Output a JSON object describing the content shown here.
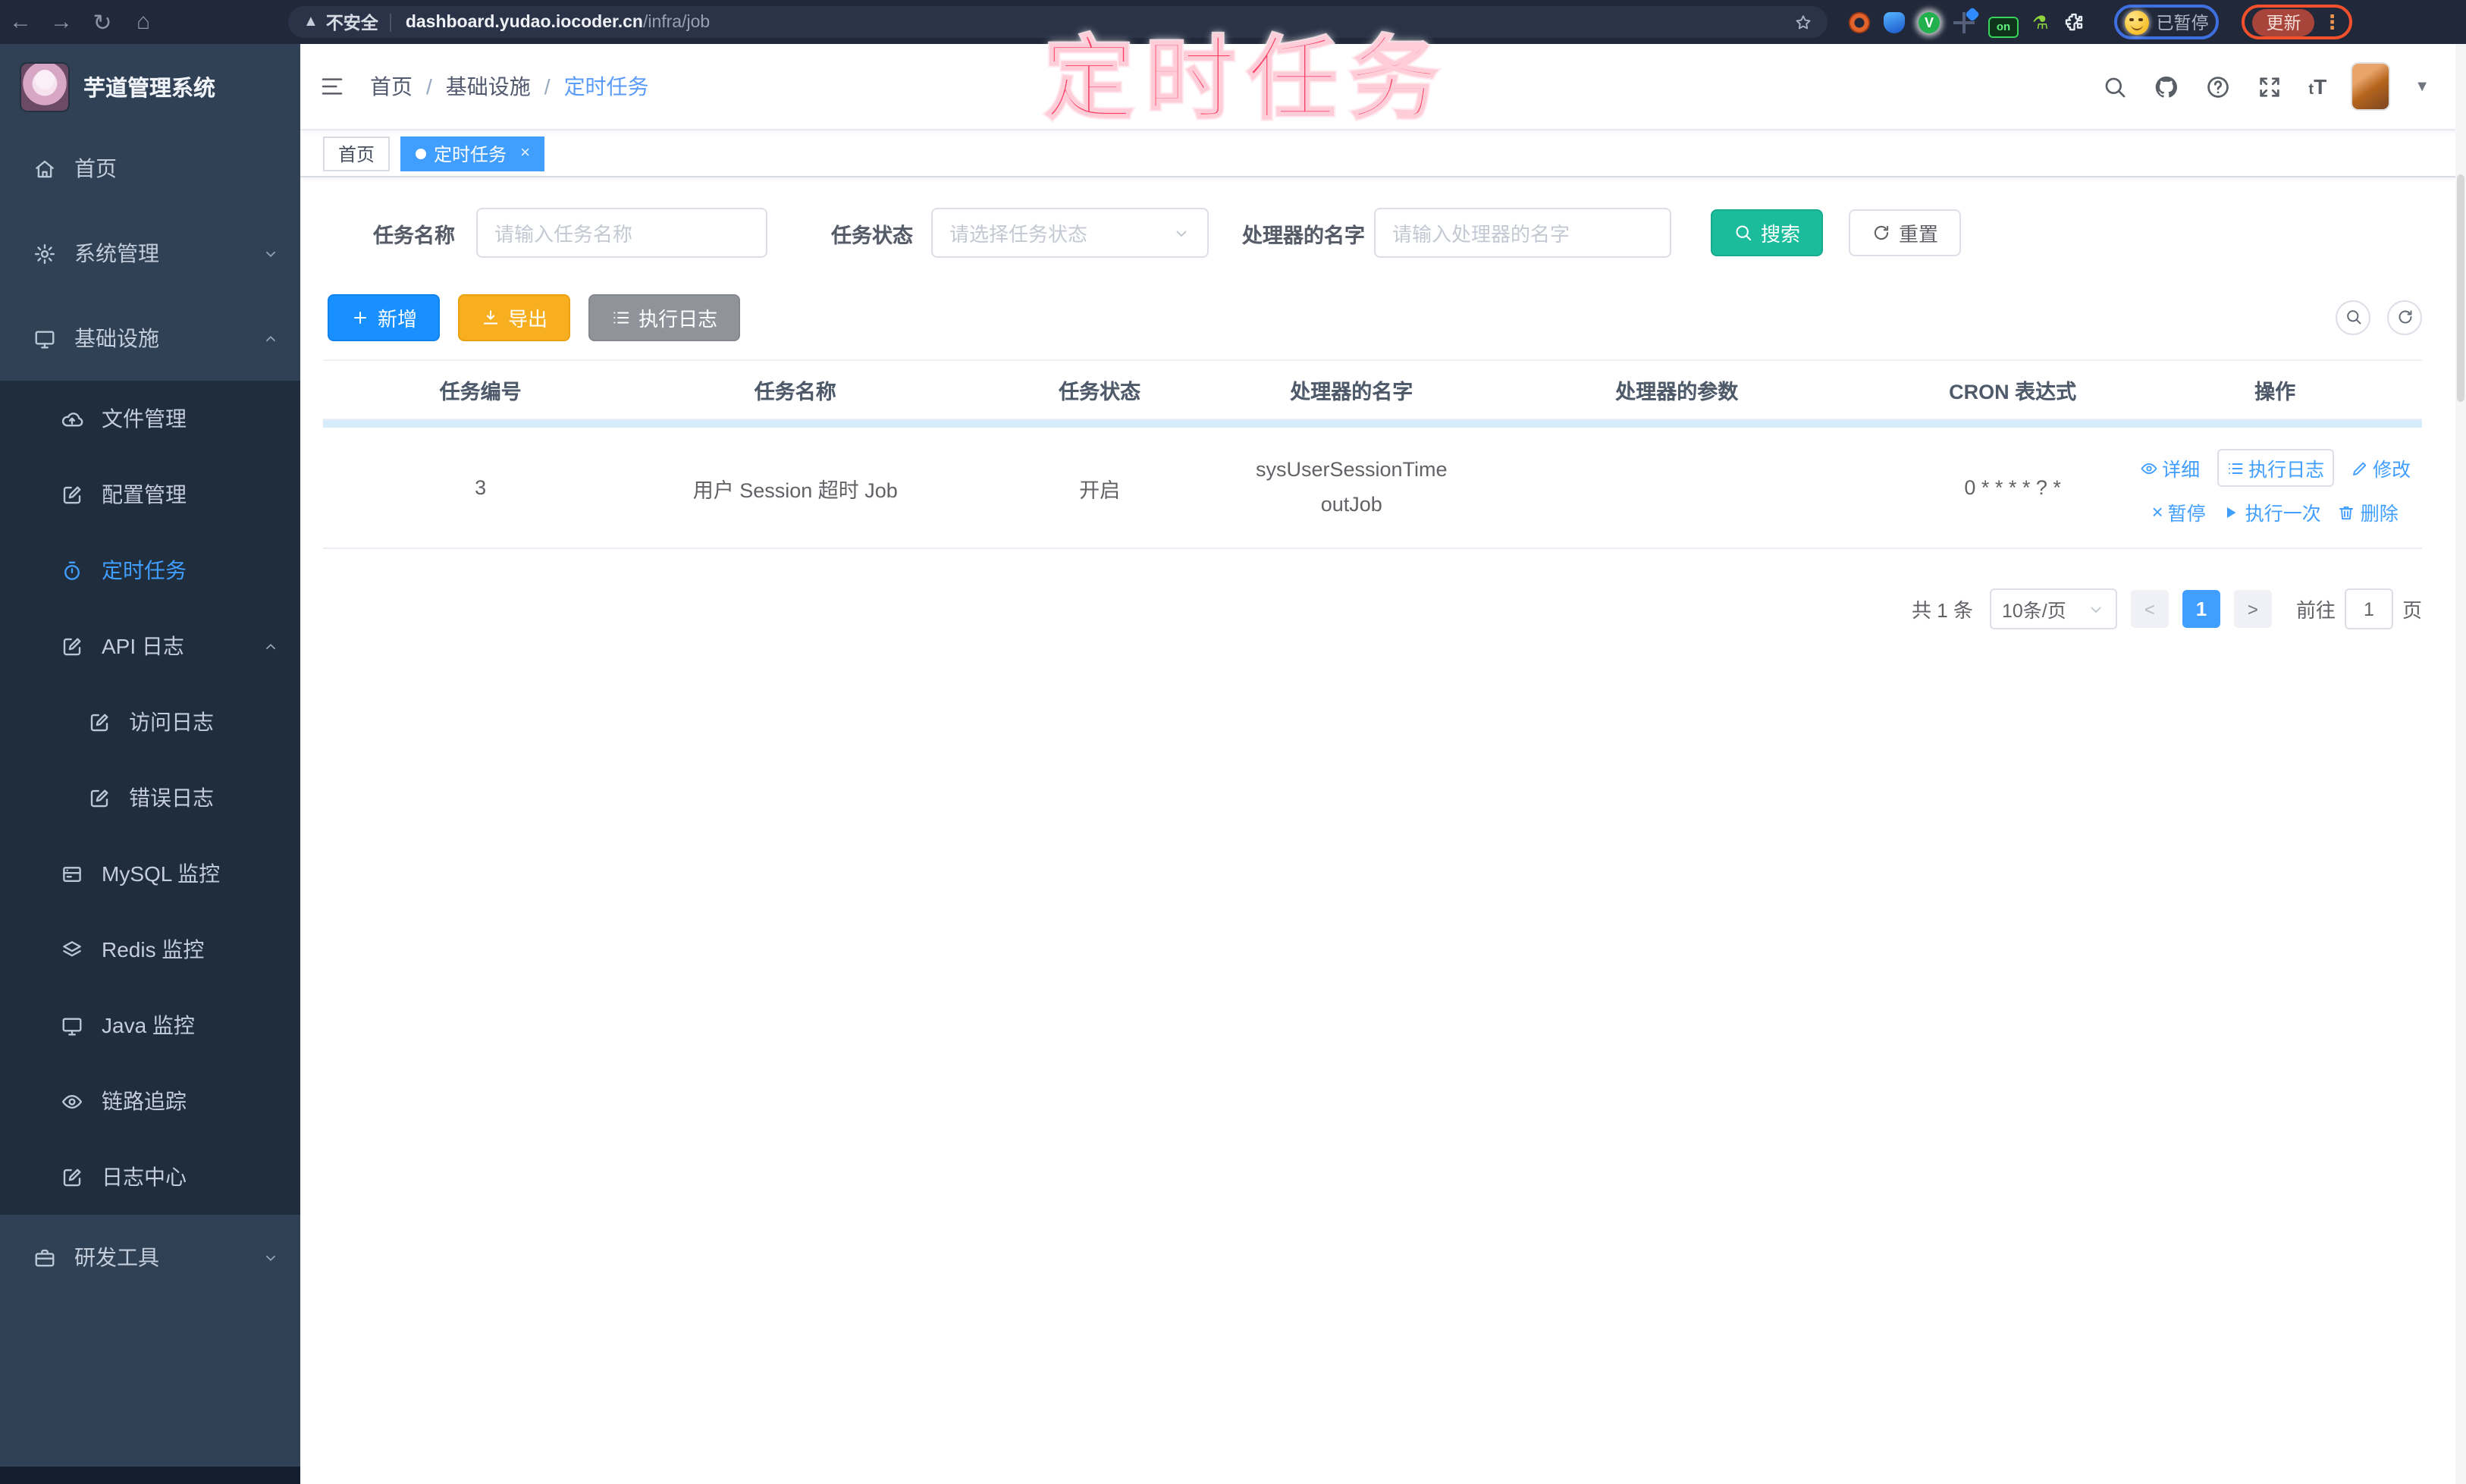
{
  "browser": {
    "security_label": "不安全",
    "url_host": "dashboard.yudao.iocoder.cn",
    "url_path": "/infra/job",
    "ext_on_badge": "on",
    "ext_green_glyph": "V",
    "paused_label": "已暂停",
    "update_label": "更新",
    "kebab_glyph": "⋮",
    "back_glyph": "←",
    "forward_glyph": "→",
    "reload_glyph": "↻",
    "home_glyph": "⌂",
    "warning_glyph": "▲"
  },
  "watermark": "定时任务",
  "sidebar": {
    "logo_title": "芋道管理系统",
    "items": [
      {
        "label": "首页"
      },
      {
        "label": "系统管理"
      },
      {
        "label": "基础设施"
      },
      {
        "label": "文件管理"
      },
      {
        "label": "配置管理"
      },
      {
        "label": "定时任务"
      },
      {
        "label": "API 日志"
      },
      {
        "label": "访问日志"
      },
      {
        "label": "错误日志"
      },
      {
        "label": "MySQL 监控"
      },
      {
        "label": "Redis 监控"
      },
      {
        "label": "Java 监控"
      },
      {
        "label": "链路追踪"
      },
      {
        "label": "日志中心"
      },
      {
        "label": "研发工具"
      }
    ]
  },
  "header": {
    "breadcrumb": [
      "首页",
      "基础设施",
      "定时任务"
    ],
    "breadcrumb_sep": "/",
    "tabs": [
      {
        "label": "首页"
      },
      {
        "label": "定时任务",
        "close_glyph": "×"
      }
    ]
  },
  "filters": {
    "name_label": "任务名称",
    "name_placeholder": "请输入任务名称",
    "status_label": "任务状态",
    "status_placeholder": "请选择任务状态",
    "handler_label": "处理器的名字",
    "handler_placeholder": "请输入处理器的名字",
    "search_label": "搜索",
    "reset_label": "重置"
  },
  "toolbar": {
    "add_label": "新增",
    "export_label": "导出",
    "exec_log_label": "执行日志"
  },
  "table": {
    "columns": [
      "任务编号",
      "任务名称",
      "任务状态",
      "处理器的名字",
      "处理器的参数",
      "CRON 表达式",
      "操作"
    ],
    "rows": [
      {
        "id": "3",
        "name": "用户 Session 超时 Job",
        "status": "开启",
        "handler": "sysUserSessionTimeoutJob",
        "param": "",
        "cron": "0 * * * * ? *"
      }
    ],
    "actions_row1": [
      "详细",
      "执行日志",
      "修改"
    ],
    "actions_row2": [
      "暂停",
      "执行一次",
      "删除"
    ],
    "pause_glyph": "×"
  },
  "pagination": {
    "total": "共 1 条",
    "page_size": "10条/页",
    "prev_glyph": "<",
    "next_glyph": ">",
    "current_page": "1",
    "goto_label": "前往",
    "goto_value": "1",
    "page_label": "页"
  }
}
